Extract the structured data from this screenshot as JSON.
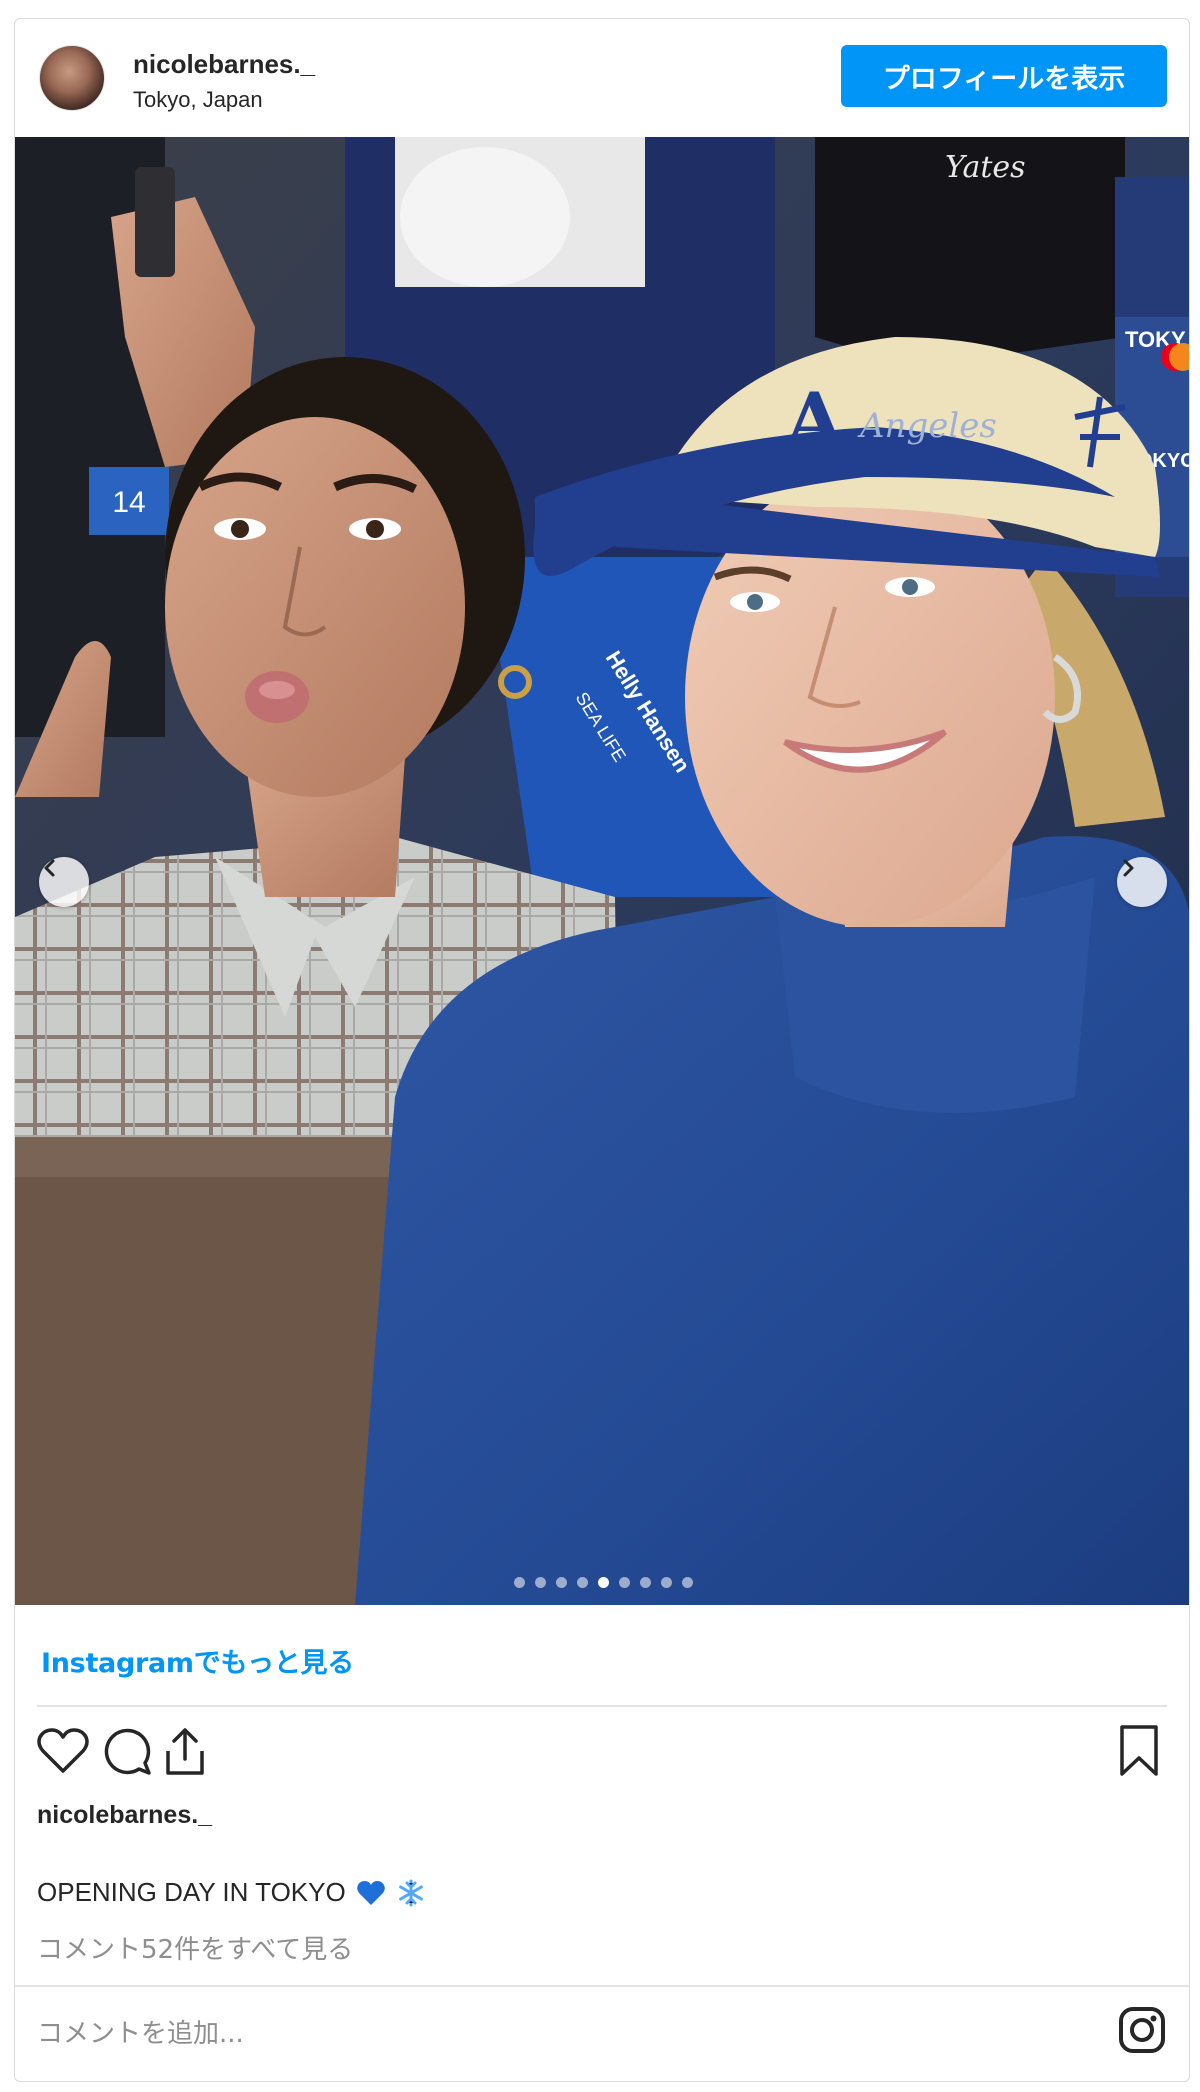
{
  "post": {
    "username": "nicolebarnes._",
    "location": "Tokyo, Japan",
    "profile_button": "プロフィールを表示",
    "more_link": "Instagramでもっと見る",
    "caption_text": "OPENING DAY IN TOKYO",
    "caption_emoji": [
      "blue-heart",
      "snowflake"
    ],
    "view_comments": "コメント52件をすべて見る",
    "add_comment_placeholder": "コメントを追加...",
    "carousel": {
      "total": 9,
      "current": 5
    }
  },
  "photo_text": {
    "cap_script": "Angeles",
    "cap_letter": "A",
    "jacket_brand": "Helly Hansen",
    "jacket_sub": "SEA LIFE",
    "seat_number": "14",
    "sign_1": "TOKY SERIE",
    "sign_2": "TOKYO SERIES",
    "patch": "Yates"
  },
  "colors": {
    "accent": "#0095f6",
    "text": "#262626",
    "muted": "#8e8e8e",
    "heart_emoji": "#1e6fd9",
    "snowflake_emoji": "#4fa8ff"
  }
}
